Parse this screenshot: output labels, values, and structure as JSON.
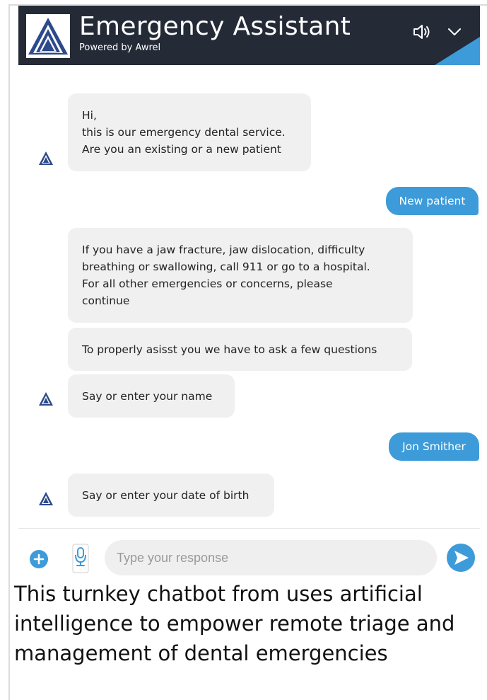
{
  "header": {
    "title": "Emergency Assistant",
    "subtitle": "Powered by Awrel",
    "speaker_icon": "speaker-icon",
    "collapse_icon": "chevron-down-icon",
    "background": "#242a36",
    "accent": "#3d9bd9"
  },
  "messages": [
    {
      "sender": "bot",
      "lines": [
        "Hi,",
        "this is our emergency dental service.",
        "Are you an existing or a new patient"
      ]
    },
    {
      "sender": "user",
      "text": "New patient"
    },
    {
      "sender": "bot",
      "lines": [
        "If you have a jaw fracture, jaw dislocation, difficulty",
        "breathing or swallowing, call 911 or go to a hospital.",
        "For all other emergencies or concerns, please",
        "continue"
      ]
    },
    {
      "sender": "bot",
      "lines": [
        "To properly asisst you we have to ask a few questions"
      ]
    },
    {
      "sender": "bot",
      "lines": [
        "Say or enter your name"
      ]
    },
    {
      "sender": "user",
      "text": "Jon Smither"
    },
    {
      "sender": "bot",
      "lines": [
        "Say or enter your date of birth"
      ]
    }
  ],
  "composer": {
    "placeholder": "Type your response",
    "value": "",
    "add_icon": "plus-circle-icon",
    "mic_icon": "microphone-icon",
    "send_icon": "send-arrow-icon"
  },
  "caption": "This turnkey chatbot from uses artificial intelligence to empower remote triage and management of dental emergencies"
}
